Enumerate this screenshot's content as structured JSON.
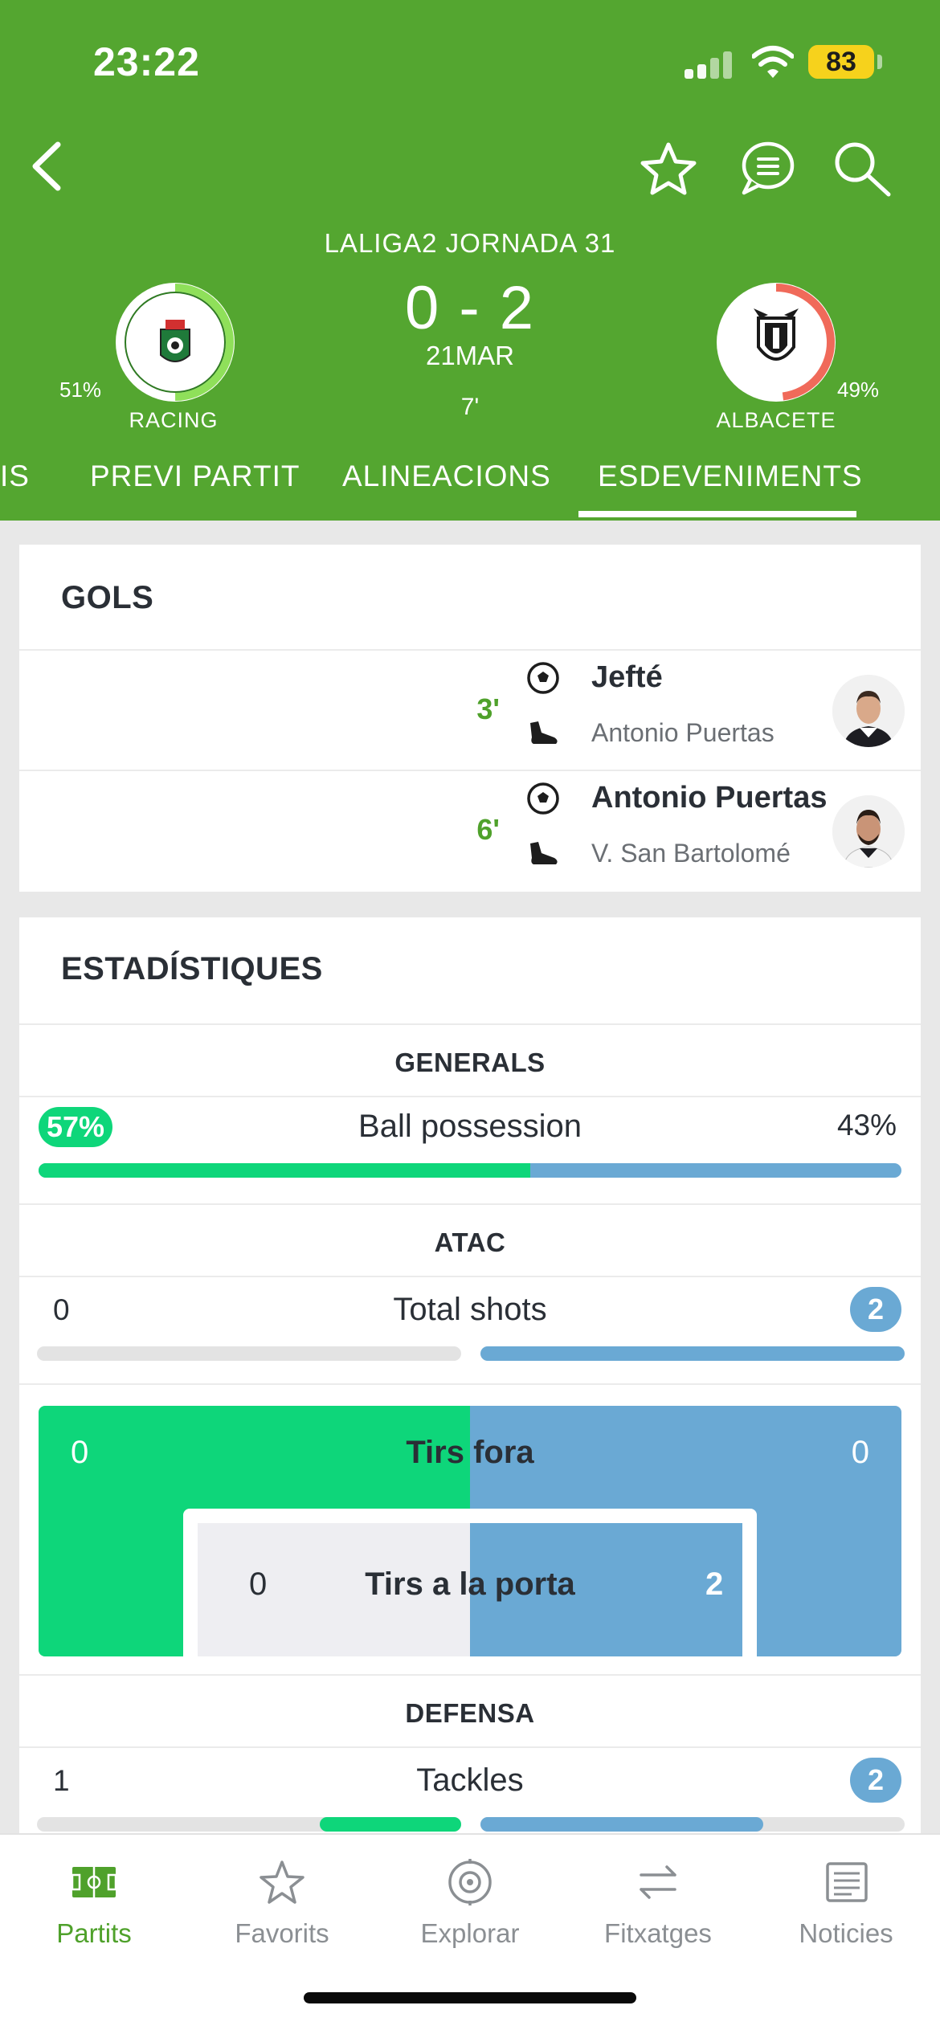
{
  "status_bar": {
    "time": "23:22",
    "battery": "83"
  },
  "header": {
    "league": "LALIGA2 JORNADA 31",
    "score": "0 - 2",
    "date": "21MAR",
    "minute": "7'",
    "home": {
      "name": "RACING",
      "pct": "51%",
      "logo_text": "REAL RACING CLUB"
    },
    "away": {
      "name": "ALBACETE",
      "pct": "49%"
    }
  },
  "tabs": [
    {
      "label": "IS"
    },
    {
      "label": "PREVI PARTIT"
    },
    {
      "label": "ALINEACIONS"
    },
    {
      "label": "ESDEVENIMENTS",
      "active": true
    }
  ],
  "goals": {
    "title": "GOLS",
    "items": [
      {
        "minute": "3'",
        "scorer": "Jefté",
        "assist": "Antonio Puertas"
      },
      {
        "minute": "6'",
        "scorer": "Antonio Puertas",
        "assist": "V. San Bartolomé"
      }
    ]
  },
  "stats": {
    "title": "ESTADÍSTIQUES",
    "generals": {
      "heading": "GENERALS",
      "possession": {
        "label": "Ball possession",
        "home": "57%",
        "away": "43%",
        "home_fraction": 0.57
      }
    },
    "atac": {
      "heading": "ATAC",
      "total_shots": {
        "label": "Total shots",
        "home": "0",
        "away": "2"
      },
      "tirs_fora": {
        "label": "Tirs fora",
        "home": "0",
        "away": "0"
      },
      "tirs_porta": {
        "label": "Tirs a la porta",
        "home": "0",
        "away": "2"
      }
    },
    "defensa": {
      "heading": "DEFENSA",
      "tackles": {
        "label": "Tackles",
        "home": "1",
        "away": "2"
      }
    }
  },
  "colors": {
    "header_green": "#54a630",
    "home_stat": "#0ed67a",
    "away_stat": "#6aa9d4",
    "away_ring": "#f06a5a"
  },
  "bottom_nav": [
    {
      "label": "Partits",
      "icon": "pitch-icon",
      "active": true
    },
    {
      "label": "Favorits",
      "icon": "star-icon"
    },
    {
      "label": "Explorar",
      "icon": "compass-icon"
    },
    {
      "label": "Fitxatges",
      "icon": "transfer-arrows-icon"
    },
    {
      "label": "Noticies",
      "icon": "news-icon"
    }
  ]
}
